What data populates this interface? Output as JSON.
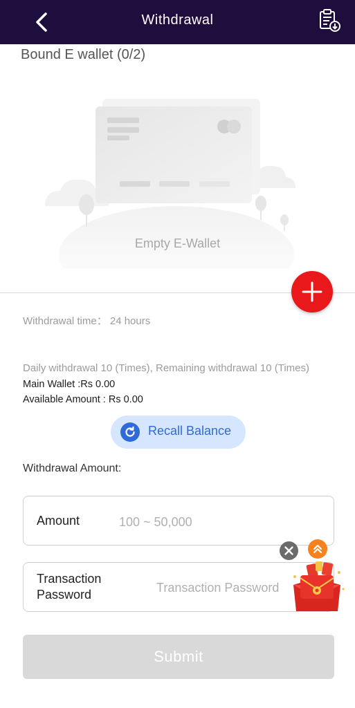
{
  "header": {
    "title": "Withdrawal",
    "back_icon": "chevron-left-icon",
    "record_icon": "clipboard-download-icon"
  },
  "wallet": {
    "section_title": "Bound E wallet (0/2)",
    "empty_label": "Empty E-Wallet",
    "add_icon": "plus-icon"
  },
  "info": {
    "withdrawal_time": "Withdrawal time： 24 hours",
    "daily_limit": "Daily withdrawal 10 (Times), Remaining withdrawal 10 (Times)",
    "main_wallet": "Main Wallet :Rs 0.00",
    "available_amount": "Available Amount : Rs 0.00"
  },
  "recall": {
    "label": "Recall Balance",
    "icon": "refresh-icon"
  },
  "form": {
    "amount_heading": "Withdrawal Amount:",
    "amount_label": "Amount",
    "amount_placeholder": "100 ~ 50,000",
    "password_label_line1": "Transaction",
    "password_label_line2": "Password",
    "password_placeholder": "Transaction Password"
  },
  "floating": {
    "close_icon": "close-icon",
    "up_icon": "double-chevron-up-icon",
    "gift_icon": "red-envelope-gift-icon"
  },
  "submit": {
    "label": "Submit"
  },
  "colors": {
    "header_bg": "#1f0e3d",
    "accent_red": "#e8181b",
    "recall_blue": "#2e6bd8",
    "recall_bg": "#d6e6ff",
    "submit_disabled": "#d9d9d9",
    "up_orange": "#f5821f"
  }
}
